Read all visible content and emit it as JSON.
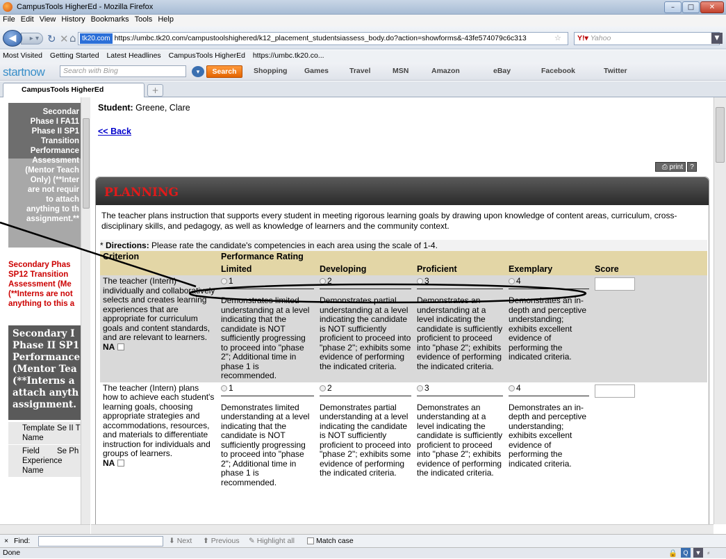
{
  "window": {
    "title": "CampusTools HigherEd - Mozilla Firefox"
  },
  "menu": [
    "File",
    "Edit",
    "View",
    "History",
    "Bookmarks",
    "Tools",
    "Help"
  ],
  "nav": {
    "site_badge": "tk20.com",
    "url": "https://umbc.tk20.com/campustoolshighered/k12_placement_studentsiassess_body.do?action=showforms&-43fe574079c6c313",
    "search_engine": "Yahoo"
  },
  "bookmarks": [
    "Most Visited",
    "Getting Started",
    "Latest Headlines",
    "CampusTools HigherEd",
    "https://umbc.tk20.co..."
  ],
  "toolbar": {
    "logo": "startnow",
    "search_placeholder": "Search with Bing",
    "search_button": "Search",
    "links": [
      "Shopping",
      "Games",
      "Travel",
      "MSN",
      "Amazon",
      "eBay",
      "Facebook",
      "Twitter"
    ]
  },
  "tab": {
    "label": "CampusTools HigherEd"
  },
  "left": {
    "gray_lines": [
      "Secondar",
      "Phase I FA11",
      "Phase II SP1",
      "Transition",
      "Performance",
      "Assessment",
      "(Mentor Teach",
      "Only) (**Inter",
      "are not requir",
      "to attach",
      "anything to th",
      "assignment.**"
    ],
    "red_lines": [
      "Secondary Phas",
      "SP12 Transition",
      "Assessment (Me",
      "(**Interns are not",
      "anything to this a"
    ],
    "dark_lines": [
      "Secondary I",
      "Phase II SP1",
      "Performance",
      "(Mentor Tea",
      "(**Interns a",
      "attach anyth",
      "assignment."
    ],
    "rows": [
      {
        "k": "Template Name",
        "v": "Se II T As"
      },
      {
        "k": "Field Experience Name",
        "v": "Se Ph Pe (M (**"
      }
    ]
  },
  "main": {
    "student_label": "Student:",
    "student_name": "Greene, Clare",
    "back": "<< Back",
    "print": "print",
    "help": "?",
    "section_title": "PLANNING",
    "description": "The teacher plans instruction that supports every student in meeting rigorous learning goals by drawing upon knowledge of content areas, curriculum, cross-disciplinary skills, and pedagogy, as well as knowledge of learners and the community context.",
    "directions_prefix": "* ",
    "directions_label": "Directions:",
    "directions_text": " Please rate the candidate's competencies in each area using the scale of 1-4.",
    "headers": {
      "criterion": "Criterion",
      "rating": "Performance Rating",
      "limited": "Limited",
      "developing": "Developing",
      "proficient": "Proficient",
      "exemplary": "Exemplary",
      "score": "Score"
    },
    "na_label": "NA",
    "rows": [
      {
        "criterion": "The teacher (Intern) individually and collaboratively selects and creates learning experiences that are appropriate for curriculum goals and content standards, and are relevant to learners.",
        "opts": [
          "1",
          "2",
          "3",
          "4"
        ],
        "limited": "Demonstrates limited understanding at a level indicating that the candidate is NOT sufficiently progressing to proceed into \"phase 2\"; Additional time in phase 1 is recommended.",
        "developing": "Demonstrates partial understanding at a level indicating the candidate is NOT sufficiently proficient to proceed into \"phase 2\"; exhibits some evidence of performing the indicated criteria.",
        "proficient": "Demonstrates an understanding at a level indicating the candidate is sufficiently proficient to proceed into \"phase 2\"; exhibits evidence of performing the indicated criteria.",
        "exemplary": "Demonstrates an in-depth and perceptive understanding; exhibits excellent evidence of performing the indicated criteria."
      },
      {
        "criterion": "The teacher (Intern) plans how to achieve each student's learning goals, choosing appropriate strategies and accommodations, resources, and materials to differentiate instruction for individuals and groups of learners.",
        "opts": [
          "1",
          "2",
          "3",
          "4"
        ],
        "limited": "Demonstrates limited understanding at a level indicating that the candidate is NOT sufficiently progressing to proceed into \"phase 2\"; Additional time in phase 1 is recommended.",
        "developing": "Demonstrates partial understanding at a level indicating the candidate is NOT sufficiently proficient to proceed into \"phase 2\"; exhibits some evidence of performing the indicated criteria.",
        "proficient": "Demonstrates an understanding at a level indicating the candidate is sufficiently proficient to proceed into \"phase 2\"; exhibits evidence of performing the indicated criteria.",
        "exemplary": "Demonstrates an in-depth and perceptive understanding; exhibits excellent evidence of performing the indicated criteria."
      }
    ]
  },
  "findbar": {
    "close": "×",
    "label": "Find:",
    "next": "Next",
    "previous": "Previous",
    "highlight": "Highlight all",
    "match": "Match case"
  },
  "status": {
    "text": "Done"
  }
}
